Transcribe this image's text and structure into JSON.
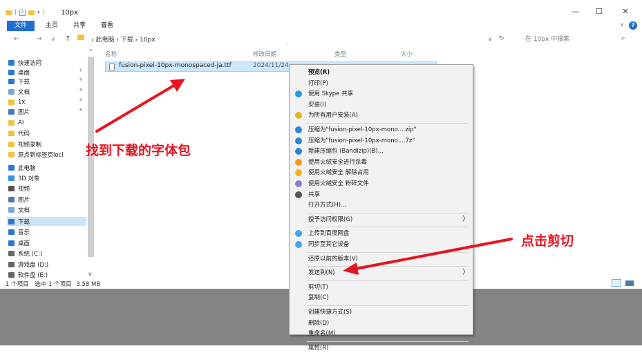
{
  "window": {
    "title": "10px",
    "minimize": "—",
    "maximize": "☐",
    "close": "✕"
  },
  "ribbon": {
    "tabs": [
      "文件",
      "主页",
      "共享",
      "查看"
    ],
    "collapse": "∨",
    "help": "?"
  },
  "address": {
    "back": "←",
    "forward": "→",
    "recent": "∨",
    "up": "↑",
    "path": "› 此电脑 › 下载 › 10px",
    "dropdown": "∨",
    "refresh": "↻",
    "search_placeholder": "在 10px 中搜索",
    "search_icon": "⌕"
  },
  "sidebar": {
    "items": [
      {
        "label": "快速访问",
        "icon": "star-icon",
        "color": "#2b78d0"
      },
      {
        "label": "桌面",
        "icon": "desktop-icon",
        "color": "#2b78d0",
        "pinned": true
      },
      {
        "label": "下载",
        "icon": "download-icon",
        "color": "#2b78d0",
        "pinned": true
      },
      {
        "label": "文档",
        "icon": "document-icon",
        "color": "#7aa7d9",
        "pinned": true
      },
      {
        "label": "1x",
        "icon": "folder-icon",
        "color": "#f2c341",
        "pinned": true
      },
      {
        "label": "图片",
        "icon": "pictures-icon",
        "color": "#4a7ab4",
        "pinned": true
      },
      {
        "label": "AI",
        "icon": "folder-icon",
        "color": "#f2c341"
      },
      {
        "label": "代码",
        "icon": "folder-icon",
        "color": "#f2c341"
      },
      {
        "label": "视频录制",
        "icon": "folder-icon",
        "color": "#f2c341"
      },
      {
        "label": "原点新标签页locl",
        "icon": "folder-icon",
        "color": "#f2c341"
      },
      {
        "label": "此电脑",
        "icon": "computer-icon",
        "color": "#2b78d0"
      },
      {
        "label": "3D 对象",
        "icon": "3d-objects-icon",
        "color": "#3a8ee6"
      },
      {
        "label": "视频",
        "icon": "video-icon",
        "color": "#555555"
      },
      {
        "label": "图片",
        "icon": "pictures-icon",
        "color": "#4a7ab4"
      },
      {
        "label": "文档",
        "icon": "document-icon",
        "color": "#7aa7d9"
      },
      {
        "label": "下载",
        "icon": "download-icon",
        "color": "#2b78d0",
        "selected": true
      },
      {
        "label": "音乐",
        "icon": "music-icon",
        "color": "#2b78d0"
      },
      {
        "label": "桌面",
        "icon": "desktop-icon",
        "color": "#2b78d0"
      },
      {
        "label": "系统 (C:)",
        "icon": "drive-icon",
        "color": "#666666"
      },
      {
        "label": "游戏盘 (D:)",
        "icon": "drive-icon",
        "color": "#666666"
      },
      {
        "label": "软件盘 (E:)",
        "icon": "drive-icon",
        "color": "#666666"
      }
    ],
    "pin_glyph": "✈"
  },
  "columns": {
    "name": "名称",
    "date": "修改日期",
    "type": "类型",
    "size": "大小"
  },
  "file": {
    "name": "fusion-pixel-10px-monospaced-ja.ttf",
    "date": "2024/11/24"
  },
  "status": {
    "count": "1 个项目",
    "selected": "选中 1 个项目",
    "size": "3.58 MB"
  },
  "context_menu": {
    "items": [
      {
        "label": "预览(R)",
        "bold": true
      },
      {
        "label": "打印(P)"
      },
      {
        "label": "使用 Skype 共享",
        "icon": "skype-icon",
        "color": "#1e9be8"
      },
      {
        "label": "安装(I)"
      },
      {
        "label": "为所有用户安装(A)",
        "icon": "shield-icon",
        "color": "#e6b422"
      },
      {
        "sep": true
      },
      {
        "label": "压缩为\"fusion-pixel-10px-mono....zip\"",
        "icon": "bandizip-icon",
        "color": "#2a86d8"
      },
      {
        "label": "压缩为\"fusion-pixel-10px-mono....7z\"",
        "icon": "bandizip-icon",
        "color": "#2a86d8"
      },
      {
        "label": "新建压缩包 (Bandizip)(B)...",
        "icon": "bandizip-icon",
        "color": "#2a86d8"
      },
      {
        "label": "使用火绒安全进行杀毒",
        "icon": "huorong-icon",
        "color": "#f39a1e"
      },
      {
        "label": "使用火绒安全 解除占用",
        "icon": "huorong-icon",
        "color": "#f3b21e"
      },
      {
        "label": "使用火绒安全 粉碎文件",
        "icon": "huorong-icon",
        "color": "#8a7bd6"
      },
      {
        "label": "共享",
        "icon": "share-icon",
        "color": "#555555"
      },
      {
        "label": "打开方式(H)..."
      },
      {
        "sep": true
      },
      {
        "label": "授予访问权限(G)",
        "submenu": true
      },
      {
        "sep": true
      },
      {
        "label": "上传到百度网盘",
        "icon": "baidu-icon",
        "color": "#3fa6f0"
      },
      {
        "label": "同步至其它设备",
        "icon": "baidu-icon",
        "color": "#3fa6f0"
      },
      {
        "sep": true
      },
      {
        "label": "还原以前的版本(V)"
      },
      {
        "sep": true
      },
      {
        "label": "发送到(N)",
        "submenu": true
      },
      {
        "sep": true
      },
      {
        "label": "剪切(T)"
      },
      {
        "label": "复制(C)"
      },
      {
        "sep": true
      },
      {
        "label": "创建快捷方式(S)"
      },
      {
        "label": "删除(D)"
      },
      {
        "label": "重命名(M)"
      },
      {
        "sep": true
      },
      {
        "label": "属性(R)"
      }
    ],
    "submenu_glyph": "〉"
  },
  "annotations": {
    "find_font": "找到下载的字体包",
    "click_cut": "点击剪切",
    "color": "#e8131f"
  }
}
